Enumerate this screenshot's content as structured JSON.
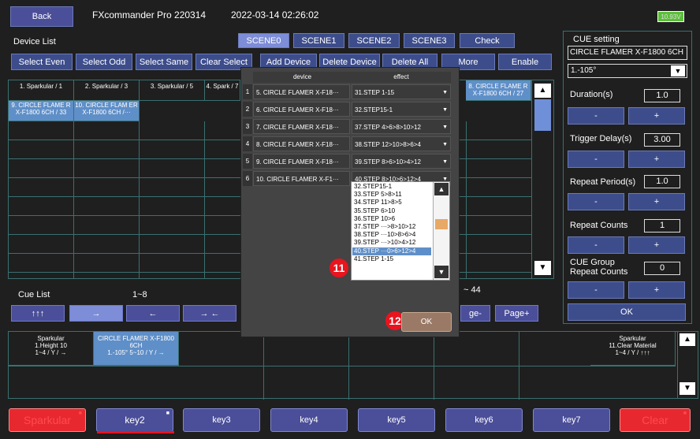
{
  "header": {
    "back": "Back",
    "app_title": "FXcommander Pro 220314",
    "datetime": "2022-03-14 02:26:02",
    "battery": "10.93V"
  },
  "device_list": {
    "title": "Device List",
    "buttons": [
      "Select Even",
      "Select Odd",
      "Select Same",
      "Clear Select",
      "Add Device",
      "Delete Device",
      "Delete All",
      "More",
      "Enable"
    ],
    "scenes": [
      "SCENE0",
      "SCENE1",
      "SCENE2",
      "SCENE3"
    ],
    "check": "Check",
    "row1": [
      "1. Sparkular / 1",
      "2. Sparkular / 3",
      "3. Sparkular / 5",
      "4. Spark / 7"
    ],
    "row2": [
      "9. CIRCLE FLAME R X-F1800 6CH / 33",
      "10. CIRCLE FLAM ER X-F1800 6CH /···"
    ],
    "right_cell": "8. CIRCLE FLAME R X-F1800 6CH / 27",
    "right_prefix": "1"
  },
  "cue_list": {
    "title": "Cue List",
    "range": "1~8",
    "range2": "~ 44",
    "buttons": [
      "↑↑↑",
      "→",
      "←",
      "→ ←"
    ],
    "page_minus": "ge-",
    "page_plus": "Page+",
    "cells": [
      {
        "t": "Sparkular",
        "s": "1.Height 10",
        "v": "1~4 / Y / →"
      },
      {
        "t": "CIRCLE FLAMER X-F1800 6CH",
        "s": "",
        "v": "1.-105° 5~10 / Y / →"
      }
    ],
    "last_cell": {
      "t": "Sparkular",
      "s": "11.Clear Material",
      "v": "1~4 / Y / ↑↑↑"
    }
  },
  "cue_setting": {
    "title": "CUE setting",
    "device": "CIRCLE FLAMER X-F1800 6CH",
    "angle": "1.-105°",
    "params": [
      {
        "label": "Duration(s)",
        "value": "1.0"
      },
      {
        "label": "Trigger Delay(s)",
        "value": "3.00"
      },
      {
        "label": "Repeat Period(s)",
        "value": "1.0"
      },
      {
        "label": "Repeat Counts",
        "value": "1"
      },
      {
        "label": "CUE Group Repeat Counts",
        "value": "0"
      }
    ],
    "minus": "-",
    "plus": "+",
    "ok": "OK"
  },
  "modal": {
    "col_device": "device",
    "col_effect": "effect",
    "rows": [
      {
        "n": "1",
        "device": "5. CIRCLE FLAMER X-F18···",
        "effect": "31.STEP 1-15"
      },
      {
        "n": "2",
        "device": "6. CIRCLE FLAMER X-F18···",
        "effect": "32.STEP15-1"
      },
      {
        "n": "3",
        "device": "7. CIRCLE FLAMER X-F18···",
        "effect": "37.STEP 4>6>8>10>12"
      },
      {
        "n": "4",
        "device": "8. CIRCLE FLAMER X-F18···",
        "effect": "38.STEP 12>10>8>6>4"
      },
      {
        "n": "5",
        "device": "9. CIRCLE FLAMER X-F18···",
        "effect": "39.STEP 8>6>10>4>12"
      },
      {
        "n": "6",
        "device": "10. CIRCLE FLAMER X-F1···",
        "effect": "40.STEP 8>10>6>12>4"
      }
    ],
    "options": [
      "32.STEP15-1",
      "33.STEP 5>8>11",
      "34.STEP 11>8>5",
      "35.STEP 6>10",
      "36.STEP 10>6",
      "37.STEP ···>8>10>12",
      "38.STEP ···10>8>6>4",
      "39.STEP ···>10>4>12",
      "40.STEP ···0>6>12>4",
      "41.STEP 1-15"
    ],
    "selected_option": "40.STEP ···0>6>12>4",
    "badge11": "11",
    "badge12": "12",
    "ok": "OK"
  },
  "keys": [
    "Sparkular",
    "key2",
    "key3",
    "key4",
    "key5",
    "key6",
    "key7",
    "Clear"
  ],
  "colors": {
    "accent": "#4b4f99",
    "badge": "#e8141e",
    "selected": "#5f8fc8"
  }
}
